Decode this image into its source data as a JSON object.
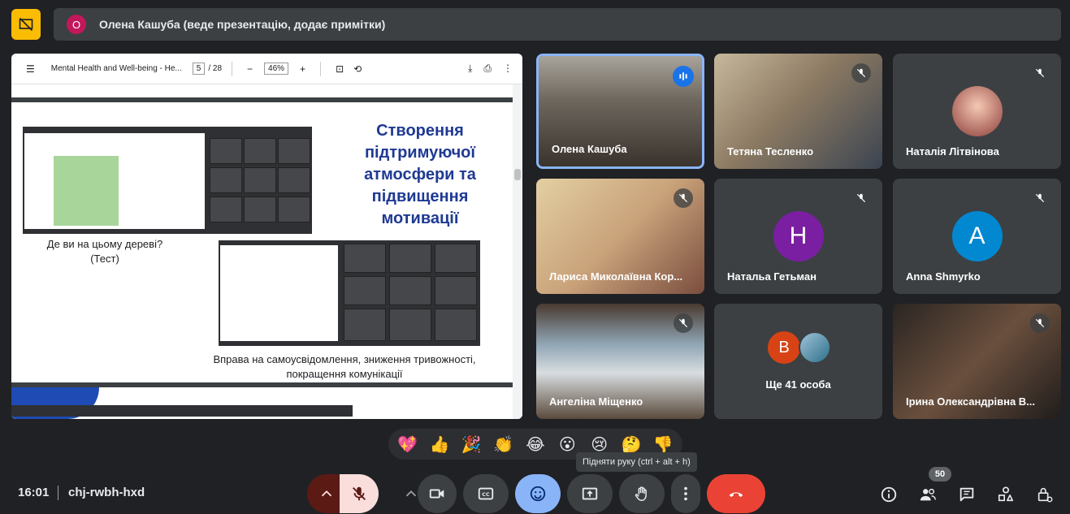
{
  "presenter": {
    "avatar_letter": "О",
    "banner_text": "Олена Кашуба (веде презентацію, додає примітки)"
  },
  "pdf": {
    "title": "Mental Health and Well-being - He...",
    "page_current": "5",
    "page_total": "/ 28",
    "zoom": "46%",
    "zoom_minus": "−",
    "zoom_plus": "+"
  },
  "slide": {
    "title": "Створення підтримуючої атмосфери та підвищення мотивації",
    "caption1": "Де ви на цьому дереві? (Тест)",
    "caption2": "Вправа на самоусвідомлення, зниження тривожності, покращення комунікації"
  },
  "tiles": [
    {
      "name": "Олена Кашуба",
      "state": "speaking"
    },
    {
      "name": "Тетяна Тесленко",
      "state": "muted"
    },
    {
      "name": "Наталія Літвінова",
      "state": "muted"
    },
    {
      "name": "Лариса Миколаївна Кор...",
      "state": "muted"
    },
    {
      "name": "Натальа Гетьман",
      "state": "muted",
      "letter": "H",
      "color": "#7b1fa2"
    },
    {
      "name": "Anna Shmyrko",
      "state": "muted",
      "letter": "A",
      "color": "#0288d1"
    },
    {
      "name": "Ангеліна Міщенко",
      "state": "muted"
    },
    {
      "name": "Ще 41 особа",
      "letter": "В",
      "color": "#d84315"
    },
    {
      "name": "Ірина Олександрівна В...",
      "state": "muted"
    }
  ],
  "reactions": [
    "💖",
    "👍",
    "🎉",
    "👏",
    "😂",
    "😮",
    "😢",
    "🤔",
    "👎"
  ],
  "tooltip": "Підняти руку (ctrl + alt + h)",
  "footer": {
    "time": "16:01",
    "meeting_code": "chj-rwbh-hxd",
    "participants_count": "50"
  },
  "colors": {
    "accent": "#8ab4f8",
    "end_call": "#ea4335",
    "mic_off": "#f9dedc",
    "emoji_active": "#8ab4f8",
    "present_badge": "#fbbc04"
  }
}
